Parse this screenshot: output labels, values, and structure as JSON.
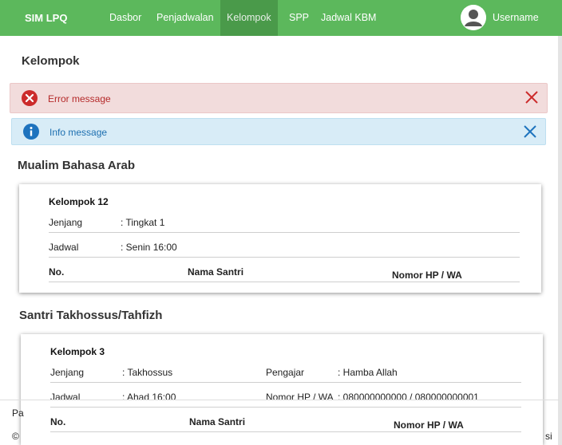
{
  "navbar": {
    "brand": "SIM LPQ",
    "items": [
      {
        "label": "Dasbor"
      },
      {
        "label": "Penjadwalan"
      },
      {
        "label": "Kelompok"
      },
      {
        "label": "SPP"
      },
      {
        "label": "Jadwal KBM"
      }
    ],
    "active_item": "Kelompok",
    "username": "Username"
  },
  "page": {
    "title": "Kelompok"
  },
  "alerts": {
    "error": {
      "text": "Error message",
      "icon": "error-circle-icon",
      "color": "#cc2b2b"
    },
    "info": {
      "text": "Info message",
      "icon": "info-circle-icon",
      "color": "#1e73be"
    }
  },
  "sections": [
    {
      "title": "Mualim Bahasa Arab",
      "group": {
        "name": "Kelompok 12",
        "jenjang_label": "Jenjang",
        "jenjang_value": ": Tingkat 1",
        "jadwal_label": "Jadwal",
        "jadwal_value": ": Senin 16:00",
        "columns": [
          "No.",
          "Nama Santri",
          "Nomor HP / WA"
        ]
      }
    },
    {
      "title": "Santri Takhossus/Tahfizh",
      "group": {
        "name": "Kelompok 3",
        "jenjang_label": "Jenjang",
        "jenjang_value": ": Takhossus",
        "pengajar_label": "Pengajar",
        "pengajar_value": ": Hamba Allah",
        "jadwal_label": "Jadwal",
        "jadwal_value": ": Ahad 16:00",
        "hp_label": "Nomor HP / WA",
        "hp_value": ": 080000000000 / 080000000001",
        "columns": [
          "No.",
          "Nama Santri",
          "Nomor HP / WA"
        ]
      }
    }
  ],
  "footer": {
    "left_fragment": "Pa",
    "copyright_fragment": "©",
    "right_fragment": "si"
  },
  "colors": {
    "navbar": "#5cb85c",
    "navbar_active": "#4a9a4a",
    "error_bg": "#f2dcdc",
    "info_bg": "#d8ecf7"
  }
}
